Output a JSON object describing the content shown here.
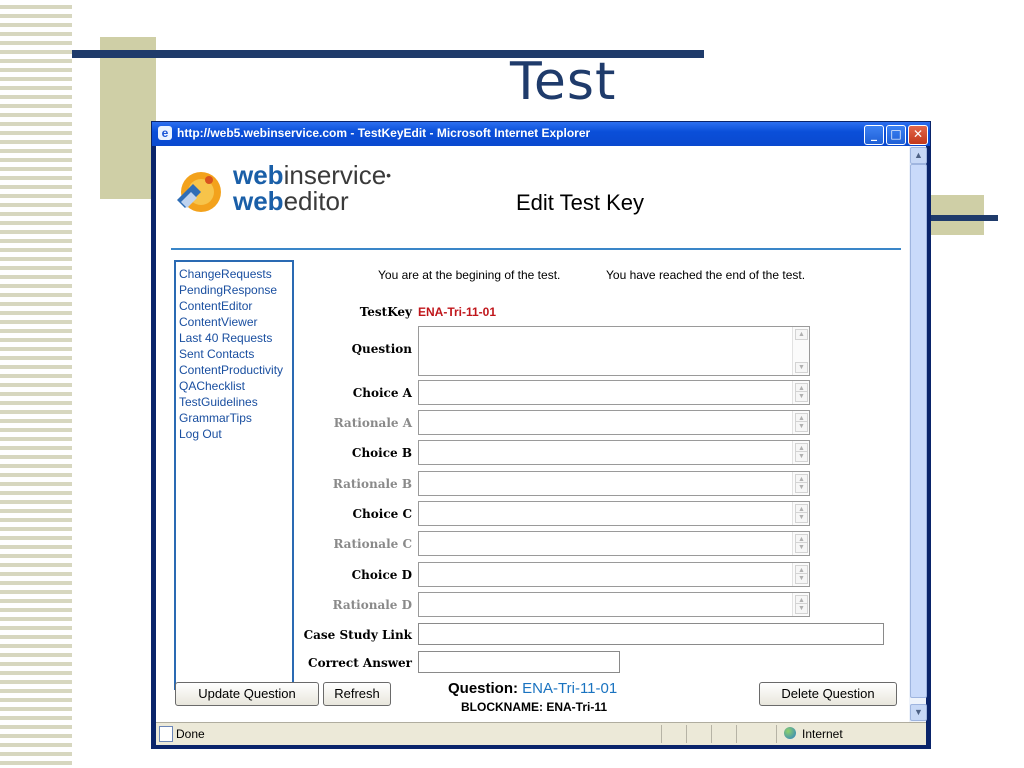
{
  "slide": {
    "title": "Test"
  },
  "window": {
    "title": "http://web5.webinservice.com - TestKeyEdit - Microsoft Internet Explorer",
    "buttons": {
      "minimize": "_",
      "maximize": "□",
      "close": "✕"
    }
  },
  "branding": {
    "line1_bold": "web",
    "line1_rest": "inservice",
    "line1_mark": "•",
    "line2_bold": "web",
    "line2_rest": "editor"
  },
  "page": {
    "heading": "Edit Test Key"
  },
  "nav": {
    "items": [
      "ChangeRequests",
      "PendingResponse",
      "ContentEditor",
      "ContentViewer",
      "Last 40 Requests",
      "Sent Contacts",
      "ContentProductivity",
      "QAChecklist",
      "TestGuidelines",
      "GrammarTips",
      "Log Out"
    ]
  },
  "messages": {
    "beginning": "You are at the begining of the test.",
    "end": "You have reached the end of the test."
  },
  "form": {
    "testkey_label": "TestKey",
    "testkey_value": "ENA-Tri-11-01",
    "question_label": "Question",
    "choice_a_label": "Choice A",
    "rationale_a_label": "Rationale A",
    "choice_b_label": "Choice B",
    "rationale_b_label": "Rationale B",
    "choice_c_label": "Choice C",
    "rationale_c_label": "Rationale C",
    "choice_d_label": "Choice D",
    "rationale_d_label": "Rationale D",
    "case_study_label": "Case Study Link",
    "correct_answer_label": "Correct Answer"
  },
  "actions": {
    "update": "Update Question",
    "refresh": "Refresh",
    "delete": "Delete Question"
  },
  "footer": {
    "question_label": "Question:",
    "question_value": "ENA-Tri-11-01",
    "blockname": "BLOCKNAME: ENA-Tri-11"
  },
  "status": {
    "text": "Done",
    "zone": "Internet"
  },
  "colors": {
    "accent": "#1f3b6b",
    "link": "#1a4fa0",
    "testkey": "#c0161b",
    "rule": "#3a86c8"
  }
}
